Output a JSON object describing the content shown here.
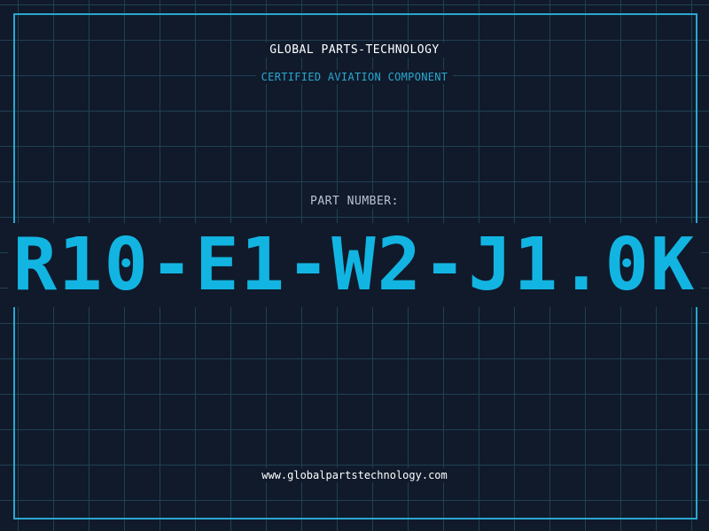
{
  "header": {
    "company": "GLOBAL PARTS-TECHNOLOGY",
    "subtitle": "CERTIFIED AVIATION COMPONENT"
  },
  "part": {
    "label": "PART NUMBER:",
    "number": "R10-E1-W2-J1.0K"
  },
  "footer": {
    "website": "www.globalpartstechnology.com"
  },
  "colors": {
    "background": "#101a2b",
    "grid": "#1f4153",
    "accent": "#2aa7cf",
    "part_number": "#12b5e2"
  }
}
